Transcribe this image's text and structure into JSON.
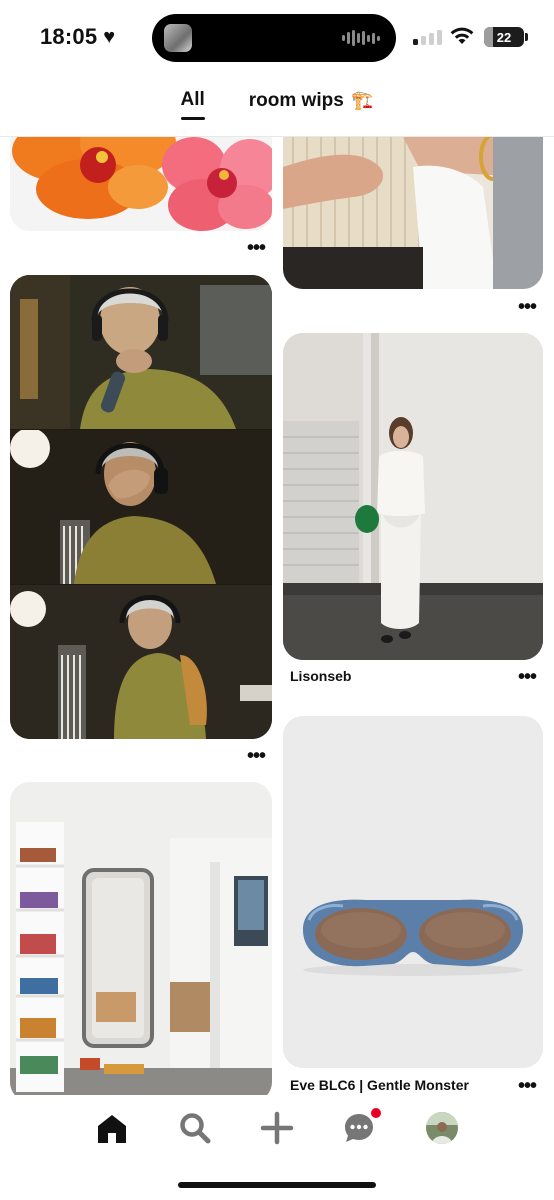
{
  "status_bar": {
    "time": "18:05",
    "heart_icon": "heart-icon",
    "battery_percent": "22",
    "battery_level": 0.22
  },
  "tabs": [
    {
      "label": "All",
      "active": true
    },
    {
      "label": "room wips",
      "emoji": "🏗️",
      "active": false
    }
  ],
  "pins": [
    {
      "description": "orange and pink hibiscus flowers"
    },
    {
      "description": "hand with gold bangle holding white cloth"
    },
    {
      "description": "three-panel photo collage of man with headphones"
    },
    {
      "title": "Lisonseb"
    },
    {
      "description": "bright room with bookshelf and floor mirror"
    },
    {
      "title": "Eve BLC6 | Gentle Monster"
    }
  ],
  "bottom_nav": [
    {
      "name": "home-icon",
      "active": true
    },
    {
      "name": "search-icon",
      "active": false
    },
    {
      "name": "create-plus-icon",
      "active": false
    },
    {
      "name": "messages-icon",
      "active": false,
      "badge": true
    },
    {
      "name": "profile-avatar",
      "active": false
    }
  ],
  "colors": {
    "accent_red": "#e60023",
    "text": "#111111",
    "icon_gray": "#767676"
  }
}
